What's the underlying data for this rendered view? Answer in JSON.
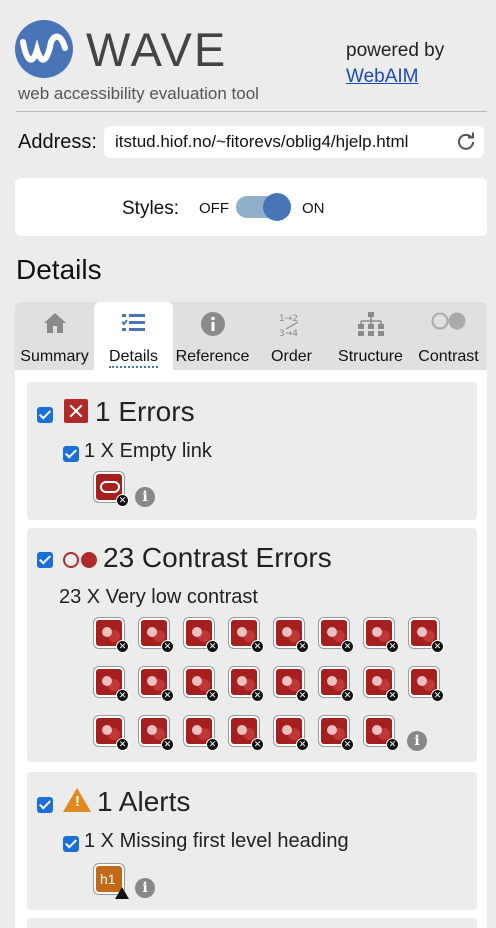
{
  "header": {
    "logo_word": "WAVE",
    "tagline": "web accessibility evaluation tool",
    "powered_by": "powered by",
    "webaim_link": "WebAIM"
  },
  "address": {
    "label": "Address:",
    "value": "itstud.hiof.no/~fitorevs/oblig4/hjelp.html"
  },
  "styles": {
    "label": "Styles:",
    "off": "OFF",
    "on": "ON",
    "state": "on"
  },
  "details_title": "Details",
  "tabs": [
    {
      "label": "Summary",
      "icon": "home-icon",
      "active": false
    },
    {
      "label": "Details",
      "icon": "list-icon",
      "active": true
    },
    {
      "label": "Reference",
      "icon": "info-icon",
      "active": false
    },
    {
      "label": "Order",
      "icon": "order-icon",
      "active": false
    },
    {
      "label": "Structure",
      "icon": "structure-icon",
      "active": false
    },
    {
      "label": "Contrast",
      "icon": "contrast-icon",
      "active": false
    }
  ],
  "errors": {
    "title": "1 Errors",
    "item": "1 X Empty link",
    "count": 1
  },
  "contrast": {
    "title": "23 Contrast Errors",
    "item": "23 X Very low contrast",
    "count": 23
  },
  "alerts": {
    "title": "1 Alerts",
    "item": "1 X Missing first level heading",
    "chip_text": "h1",
    "count": 1
  },
  "colors": {
    "brand": "#4a74b8",
    "error": "#b02a2a",
    "alert": "#e08a1e",
    "link": "#1a4bb8"
  }
}
